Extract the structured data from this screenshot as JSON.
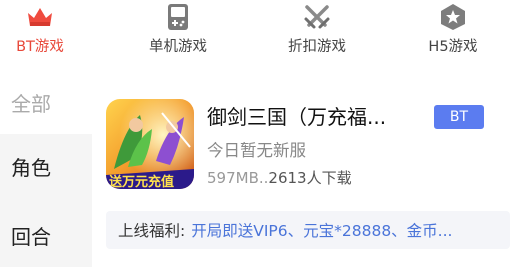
{
  "top_tabs": [
    {
      "label": "BT游戏",
      "icon": "crown-icon",
      "active": true
    },
    {
      "label": "单机游戏",
      "icon": "gamepad-icon",
      "active": false
    },
    {
      "label": "折扣游戏",
      "icon": "crossed-swords-icon",
      "active": false
    },
    {
      "label": "H5游戏",
      "icon": "hexagon-star-icon",
      "active": false
    }
  ],
  "sidebar": {
    "items": [
      {
        "label": "全部"
      },
      {
        "label": "角色"
      },
      {
        "label": "回合"
      }
    ]
  },
  "game": {
    "title": "御剑三国（万充福...",
    "badge": "BT",
    "subtitle": "今日暂无新服",
    "size": "597MB",
    "sep": "..",
    "downloads": "2613人下载",
    "thumb_caption": "送万元充值",
    "welfare_label": "上线福利:",
    "welfare_text": "开局即送VIP6、元宝*28888、金币..."
  },
  "colors": {
    "accent": "#e8483a",
    "badge": "#5b7cf0",
    "link": "#4a74d9"
  }
}
